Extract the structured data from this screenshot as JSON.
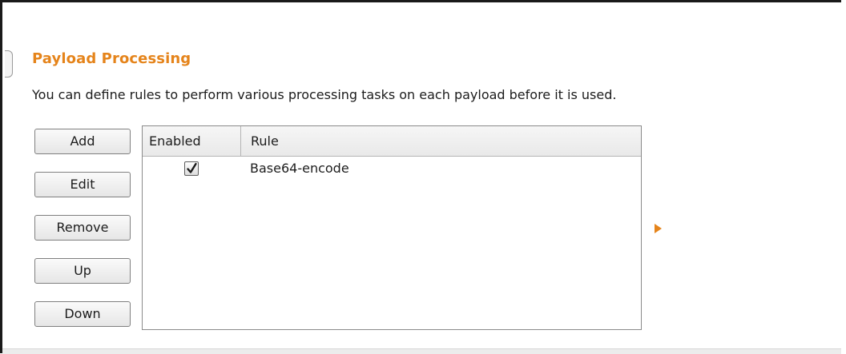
{
  "section": {
    "title": "Payload Processing",
    "description": "You can define rules to perform various processing tasks on each payload before it is used."
  },
  "buttons": {
    "add": "Add",
    "edit": "Edit",
    "remove": "Remove",
    "up": "Up",
    "down": "Down"
  },
  "table": {
    "columns": [
      "Enabled",
      "Rule"
    ],
    "rows": [
      {
        "enabled": true,
        "rule": "Base64-encode"
      }
    ]
  },
  "icons": {
    "collapse": "collapse-tab-icon",
    "expand": "expand-arrow-icon",
    "check": "checkmark-icon"
  },
  "colors": {
    "accent": "#e5841b",
    "border": "#8a8a8a"
  }
}
